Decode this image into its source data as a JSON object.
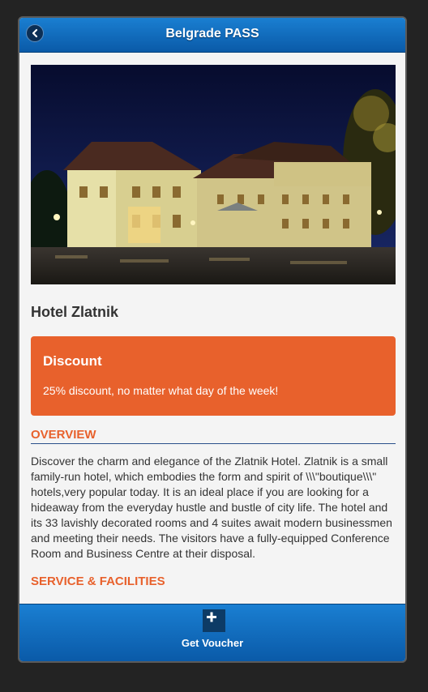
{
  "header": {
    "title": "Belgrade PASS",
    "back_icon": "back-arrow-icon"
  },
  "hotel": {
    "name": "Hotel Zlatnik"
  },
  "discount": {
    "title": "Discount",
    "text": "25% discount, no matter what day of the week!",
    "color": "#e8612c"
  },
  "overview": {
    "heading": "OVERVIEW",
    "text": "Discover the charm and elegance of the Zlatnik Hotel. Zlatnik is a small family-run hotel, which embodies the form and spirit of \\\\\\\"boutique\\\\\\\" hotels,very popular today. It is an ideal place if you are looking for a hideaway from the everyday hustle and bustle of city life. The hotel and its 33 lavishly decorated rooms and 4 suites await modern businessmen and meeting their needs. The visitors have a fully-equipped Conference Room and Business Centre at their disposal."
  },
  "services": {
    "heading": "SERVICE & FACILITIES"
  },
  "footer": {
    "voucher_label": "Get Voucher",
    "voucher_icon": "plus-icon"
  },
  "colors": {
    "header_blue": "#0a5aa8",
    "accent_orange": "#e8612c"
  }
}
